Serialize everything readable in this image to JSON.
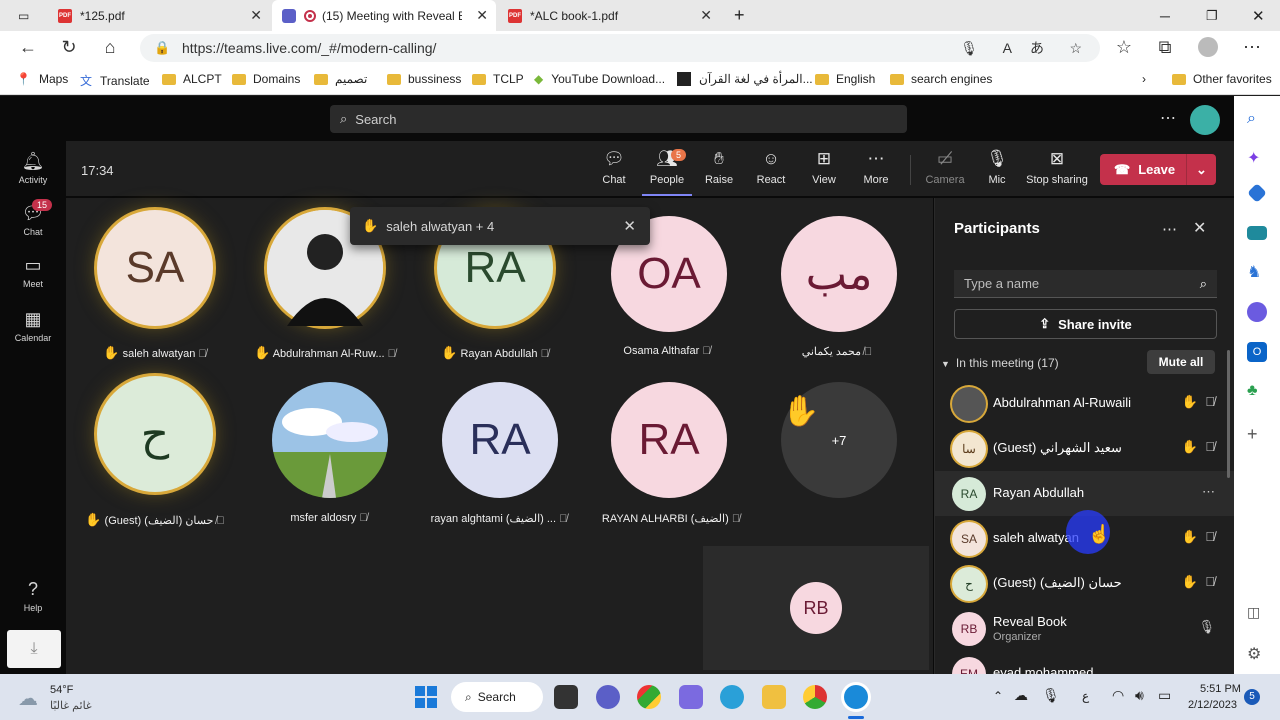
{
  "browser": {
    "tabs": [
      {
        "label": "*125.pdf"
      },
      {
        "label": "(15) Meeting with Reveal Bo"
      },
      {
        "label": "*ALC book-1.pdf"
      }
    ],
    "url": "https://teams.live.com/_#/modern-calling/",
    "favorites": [
      "Maps",
      "Translate",
      "ALCPT",
      "Domains",
      "تصميم",
      "bussiness",
      "TCLP",
      "YouTube Download...",
      "المرأة في لغة القرآن...",
      "English",
      "search engines"
    ],
    "other_favorites": "Other favorites"
  },
  "teams": {
    "search_placeholder": "Search",
    "rail": [
      {
        "label": "Activity"
      },
      {
        "label": "Chat",
        "badge": "15"
      },
      {
        "label": "Meet"
      },
      {
        "label": "Calendar"
      },
      {
        "label": "Help"
      }
    ],
    "meeting_time": "17:34",
    "controls": {
      "chat": "Chat",
      "people": "People",
      "people_badge": "5",
      "raise": "Raise",
      "react": "React",
      "view": "View",
      "more": "More",
      "camera": "Camera",
      "mic": "Mic",
      "stop_sharing": "Stop sharing",
      "leave": "Leave"
    },
    "raised_popup": "saleh alwatyan + 4",
    "tiles": [
      {
        "initials": "SA",
        "name": "saleh alwatyan"
      },
      {
        "initials": "",
        "name": "Abdulrahman Al-Ruw..."
      },
      {
        "initials": "RA",
        "name": "Rayan Abdullah"
      },
      {
        "initials": "OA",
        "name": "Osama Althafar"
      },
      {
        "initials": "مب",
        "name": "محمد يكماني"
      },
      {
        "initials": "ح",
        "name": "(Guest) (الضيف) حسان"
      },
      {
        "initials": "",
        "name": "msfer aldosry"
      },
      {
        "initials": "RA",
        "name": "rayan alghtami (الضيف) ..."
      },
      {
        "initials": "RA",
        "name": "RAYAN ALHARBI (الضيف)"
      },
      {
        "initials": "+7",
        "name": ""
      }
    ],
    "self_view_initials": "RB"
  },
  "participants": {
    "title": "Participants",
    "search_placeholder": "Type a name",
    "share_invite": "Share invite",
    "in_meeting": "In this meeting (17)",
    "mute_all": "Mute all",
    "list": [
      {
        "initials": "",
        "name": "Abdulrahman Al-Ruwaili",
        "sub": ""
      },
      {
        "initials": "سا",
        "name": "(Guest) سعيد الشهراني",
        "sub": ""
      },
      {
        "initials": "RA",
        "name": "Rayan Abdullah",
        "sub": ""
      },
      {
        "initials": "SA",
        "name": "saleh alwatyan",
        "sub": ""
      },
      {
        "initials": "ح",
        "name": "(Guest) (الضيف) حسان",
        "sub": ""
      },
      {
        "initials": "RB",
        "name": "Reveal Book",
        "sub": "Organizer"
      },
      {
        "initials": "EM",
        "name": "eyad mohammed",
        "sub": ""
      }
    ]
  },
  "taskbar": {
    "weather_temp": "54°F",
    "weather_desc": "غائم غالبًا",
    "search": "Search",
    "lang": "ع",
    "time": "5:51 PM",
    "date": "2/12/2023",
    "notif_count": "5"
  }
}
